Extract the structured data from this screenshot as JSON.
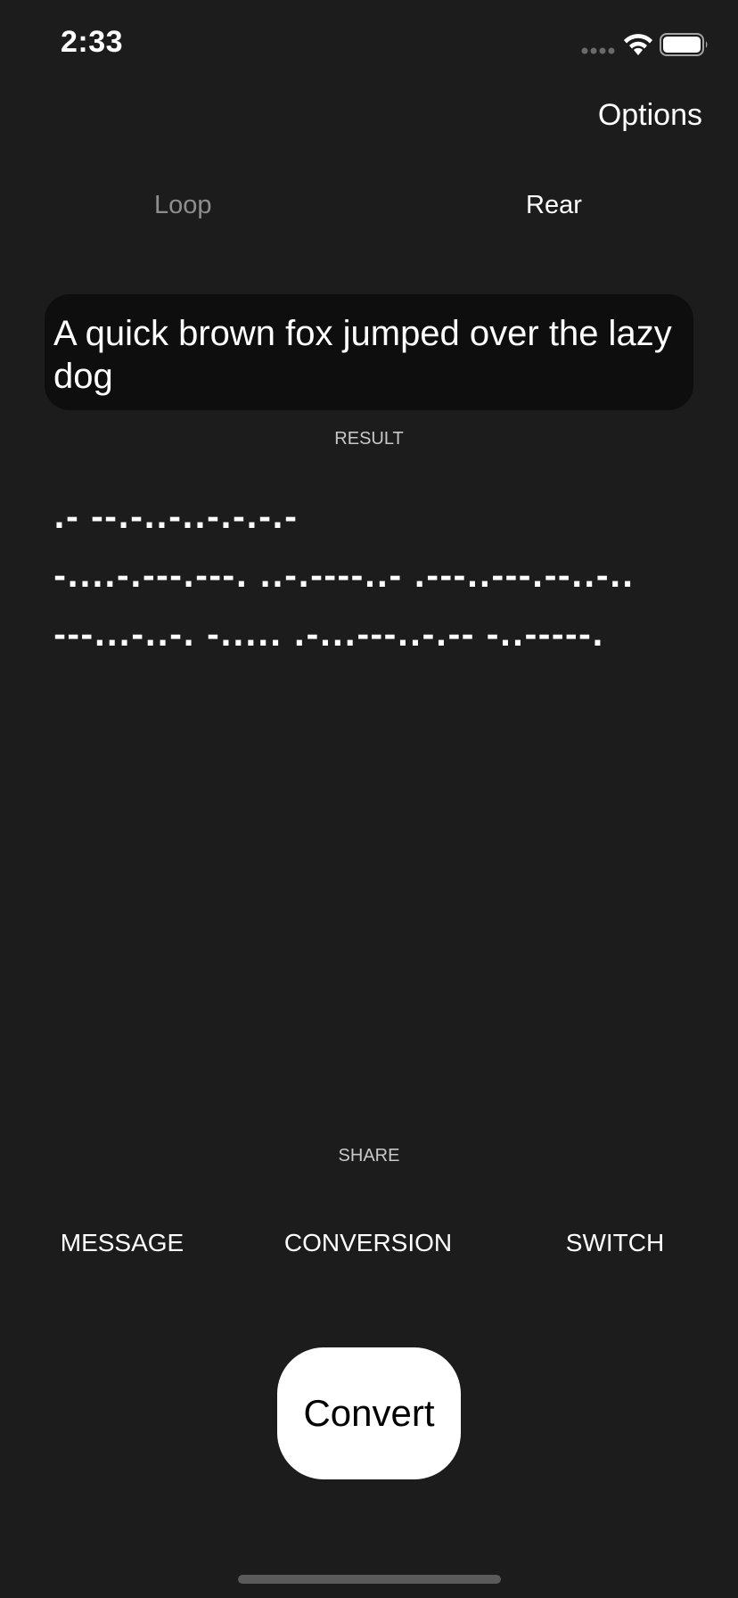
{
  "status_bar": {
    "time": "2:33",
    "icons": [
      "signal-icon",
      "wifi-icon",
      "battery-icon"
    ]
  },
  "header": {
    "options_label": "Options"
  },
  "tabs": [
    {
      "label": "Loop",
      "selected": false
    },
    {
      "label": "Rear",
      "selected": true
    }
  ],
  "input": {
    "text": "A quick brown fox jumped over the lazy dog"
  },
  "result": {
    "label": "RESULT",
    "lines": [
      ".- --.-..-..-.-.-.-",
      "-....-.---.---. ..-.----..- .---..---.--..-..",
      "---...-..-. -..... .-...---..-.-- -..-----."
    ]
  },
  "share": {
    "label": "SHARE"
  },
  "actions": {
    "message": "MESSAGE",
    "conversion": "CONVERSION",
    "switch": "SWITCH"
  },
  "convert_button": {
    "label": "Convert"
  },
  "colors": {
    "background": "#1c1c1c",
    "input_background": "#0e0e0e",
    "text": "#ffffff",
    "muted_text": "#8e8e8e",
    "button_background": "#ffffff",
    "button_text": "#000000"
  }
}
